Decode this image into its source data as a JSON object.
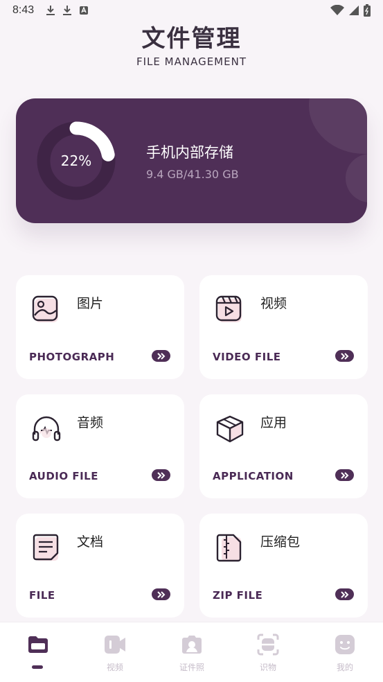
{
  "status_bar": {
    "time": "8:43",
    "left_icons": [
      "download-icon",
      "download-icon",
      "app-notification-icon"
    ],
    "right_icons": [
      "wifi-icon",
      "signal-icon",
      "battery-icon"
    ]
  },
  "header": {
    "title": "文件管理",
    "subtitle": "FILE MANAGEMENT"
  },
  "storage": {
    "percent_label": "22%",
    "percent_value": 0.22,
    "name": "手机内部存储",
    "size": "9.4 GB/41.30 GB",
    "card_color": "#4f2f57"
  },
  "categories": [
    {
      "cn": "图片",
      "en": "PHOTOGRAPH",
      "icon": "photo-icon"
    },
    {
      "cn": "视频",
      "en": "VIDEO FILE",
      "icon": "video-icon"
    },
    {
      "cn": "音频",
      "en": "AUDIO FILE",
      "icon": "headphones-icon"
    },
    {
      "cn": "应用",
      "en": "APPLICATION",
      "icon": "package-icon"
    },
    {
      "cn": "文档",
      "en": "FILE",
      "icon": "document-icon"
    },
    {
      "cn": "压缩包",
      "en": "ZIP FILE",
      "icon": "zip-icon"
    }
  ],
  "bottom_nav": {
    "items": [
      {
        "label": "",
        "icon": "folder-icon",
        "active": true
      },
      {
        "label": "视频",
        "icon": "video-camera-icon",
        "active": false
      },
      {
        "label": "证件照",
        "icon": "camera-icon",
        "active": false
      },
      {
        "label": "识物",
        "icon": "scan-icon",
        "active": false
      },
      {
        "label": "我的",
        "icon": "profile-icon",
        "active": false
      }
    ]
  },
  "colors": {
    "accent": "#4f2f57",
    "background": "#f8f4f8",
    "icon_tint": "#f6dfe4",
    "nav_inactive": "#d4ccd6"
  }
}
